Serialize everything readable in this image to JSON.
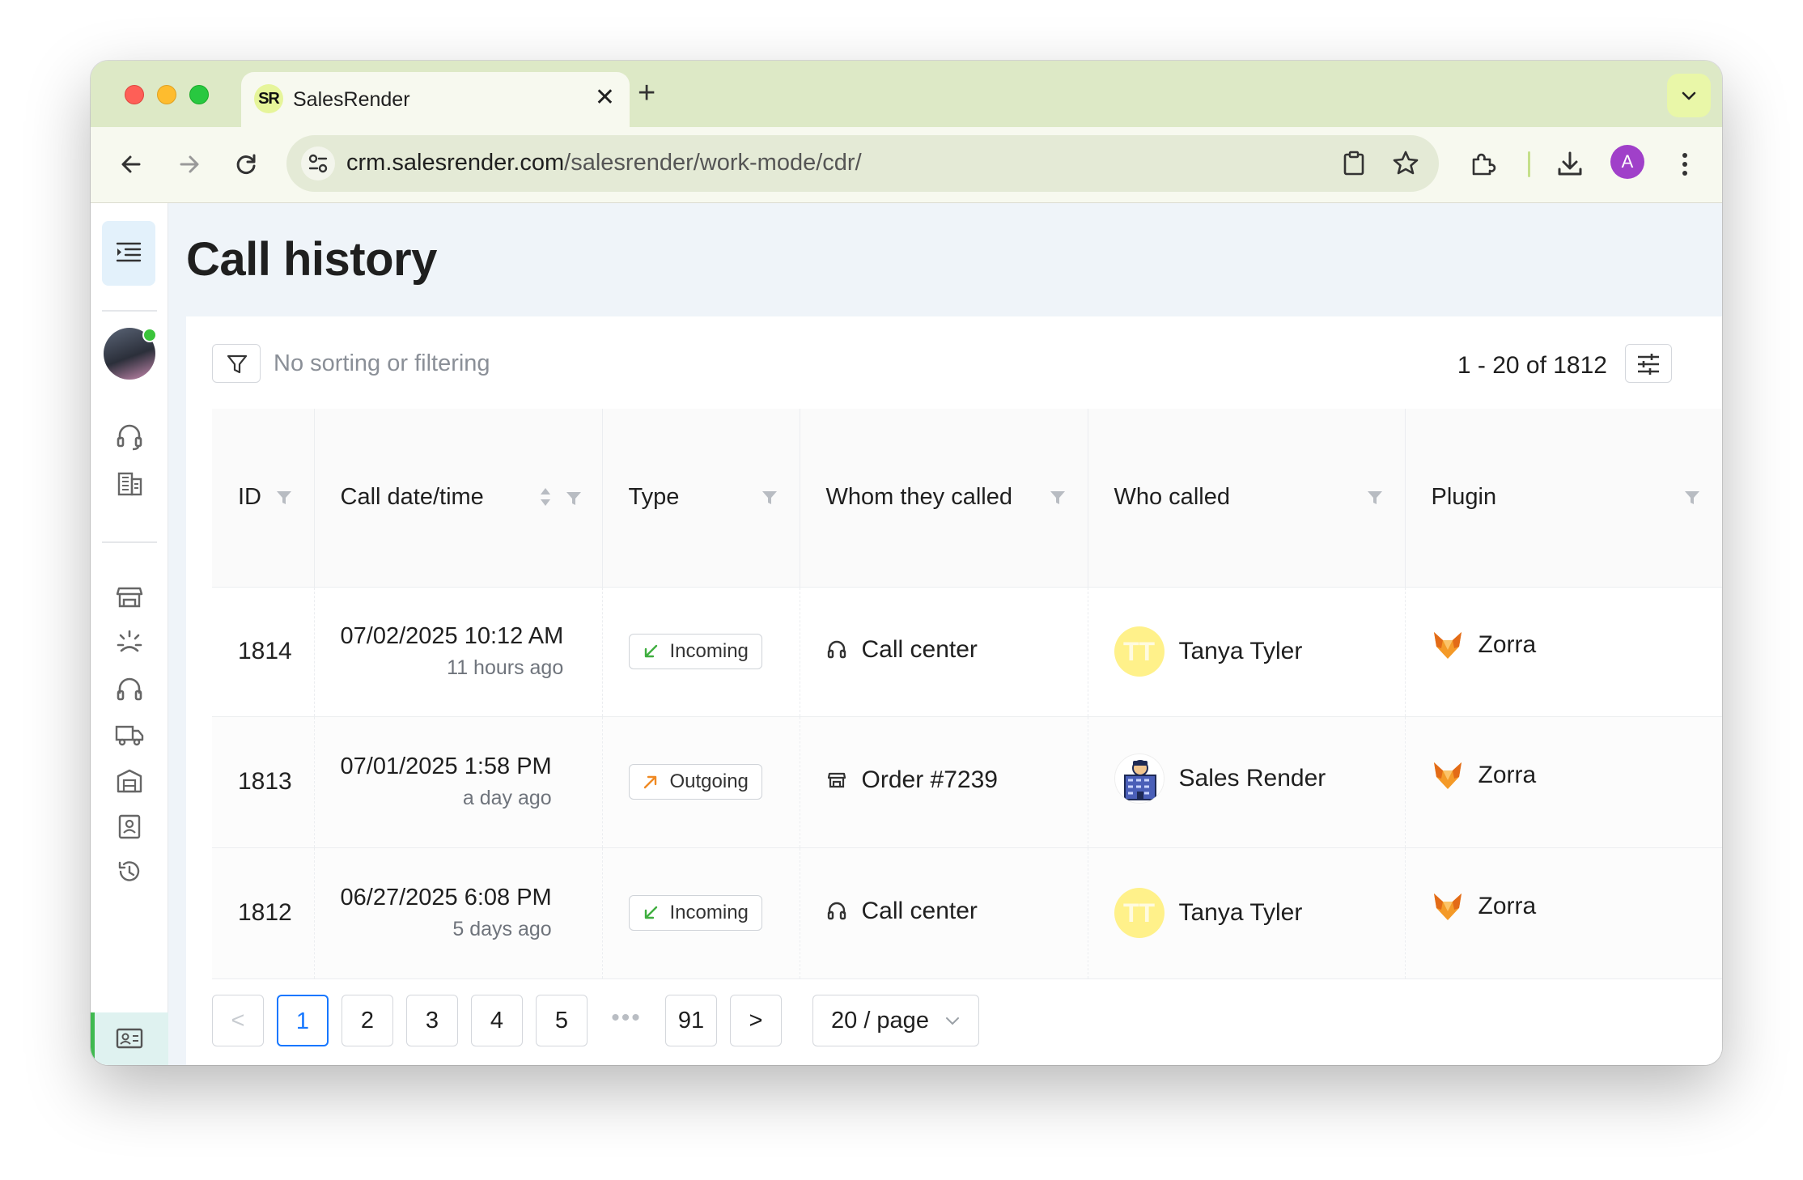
{
  "browser": {
    "tab_title": "SalesRender",
    "tab_favicon_text": "SR",
    "url_host": "crm.salesrender.com",
    "url_path": "/salesrender/work-mode/cdr/",
    "profile_initial": "A"
  },
  "page": {
    "title": "Call history",
    "filter_text": "No sorting or filtering",
    "range_text": "1 - 20 of 1812"
  },
  "table": {
    "columns": [
      "ID",
      "Call date/time",
      "Type",
      "Whom they called",
      "Who called",
      "Plugin"
    ],
    "rows": [
      {
        "id": "1814",
        "datetime": "07/02/2025 10:12 AM",
        "relative": "11 hours ago",
        "type": "Incoming",
        "whom": "Call center",
        "whom_icon": "headset-icon",
        "who": "Tanya Tyler",
        "who_avatar": "TT",
        "plugin": "Zorra"
      },
      {
        "id": "1813",
        "datetime": "07/01/2025 1:58 PM",
        "relative": "a day ago",
        "type": "Outgoing",
        "whom": "Order #7239",
        "whom_icon": "store-icon",
        "who": "Sales Render",
        "who_avatar": "",
        "plugin": "Zorra"
      },
      {
        "id": "1812",
        "datetime": "06/27/2025 6:08 PM",
        "relative": "5 days ago",
        "type": "Incoming",
        "whom": "Call center",
        "whom_icon": "headset-icon",
        "who": "Tanya Tyler",
        "who_avatar": "TT",
        "plugin": "Zorra"
      }
    ]
  },
  "pagination": {
    "pages": [
      "1",
      "2",
      "3",
      "4",
      "5"
    ],
    "ellipsis": "•••",
    "last": "91",
    "current": "1",
    "page_size": "20 / page"
  },
  "colors": {
    "accent": "#1677ff",
    "incoming": "#3fae3f",
    "outgoing": "#f08a24",
    "avatar_yellow": "#fff18a",
    "tabstrip": "#dde9c6"
  }
}
